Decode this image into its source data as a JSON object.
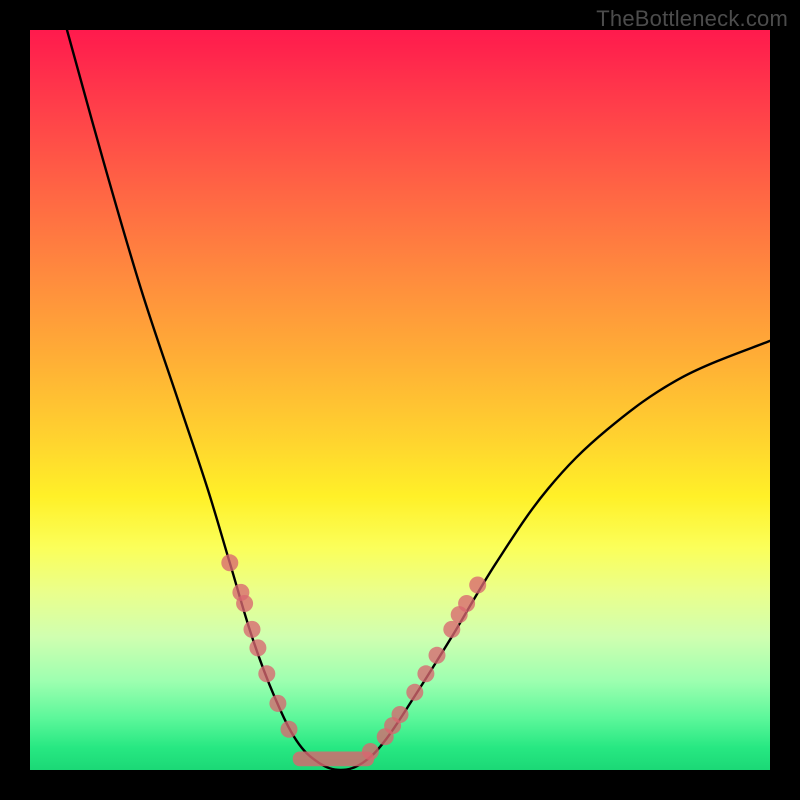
{
  "watermark": "TheBottleneck.com",
  "chart_data": {
    "type": "line",
    "title": "",
    "xlabel": "",
    "ylabel": "",
    "xlim": [
      0,
      100
    ],
    "ylim": [
      0,
      100
    ],
    "curve": {
      "name": "bottleneck-curve",
      "points": [
        {
          "x": 5,
          "y": 100
        },
        {
          "x": 10,
          "y": 82
        },
        {
          "x": 15,
          "y": 65
        },
        {
          "x": 20,
          "y": 50
        },
        {
          "x": 24,
          "y": 38
        },
        {
          "x": 27,
          "y": 28
        },
        {
          "x": 30,
          "y": 18
        },
        {
          "x": 33,
          "y": 10
        },
        {
          "x": 36,
          "y": 4
        },
        {
          "x": 39,
          "y": 1
        },
        {
          "x": 42,
          "y": 0
        },
        {
          "x": 45,
          "y": 1
        },
        {
          "x": 48,
          "y": 4
        },
        {
          "x": 52,
          "y": 10
        },
        {
          "x": 57,
          "y": 18
        },
        {
          "x": 63,
          "y": 28
        },
        {
          "x": 70,
          "y": 38
        },
        {
          "x": 78,
          "y": 46
        },
        {
          "x": 88,
          "y": 53
        },
        {
          "x": 100,
          "y": 58
        }
      ]
    },
    "scatter_left": {
      "name": "left-cluster",
      "color": "#d8666f",
      "points": [
        {
          "x": 27.0,
          "y": 28.0
        },
        {
          "x": 28.5,
          "y": 24.0
        },
        {
          "x": 29.0,
          "y": 22.5
        },
        {
          "x": 30.0,
          "y": 19.0
        },
        {
          "x": 30.8,
          "y": 16.5
        },
        {
          "x": 32.0,
          "y": 13.0
        },
        {
          "x": 33.5,
          "y": 9.0
        },
        {
          "x": 35.0,
          "y": 5.5
        }
      ]
    },
    "scatter_right": {
      "name": "right-cluster",
      "color": "#d8666f",
      "points": [
        {
          "x": 46.0,
          "y": 2.5
        },
        {
          "x": 48.0,
          "y": 4.5
        },
        {
          "x": 49.0,
          "y": 6.0
        },
        {
          "x": 50.0,
          "y": 7.5
        },
        {
          "x": 52.0,
          "y": 10.5
        },
        {
          "x": 53.5,
          "y": 13.0
        },
        {
          "x": 55.0,
          "y": 15.5
        },
        {
          "x": 57.0,
          "y": 19.0
        },
        {
          "x": 58.0,
          "y": 21.0
        },
        {
          "x": 59.0,
          "y": 22.5
        },
        {
          "x": 60.5,
          "y": 25.0
        }
      ]
    },
    "bottom_band": {
      "name": "bottom-band",
      "color": "#d8666f",
      "x_start": 35.5,
      "x_end": 46.5,
      "y": 0.5,
      "height": 2.0
    }
  }
}
